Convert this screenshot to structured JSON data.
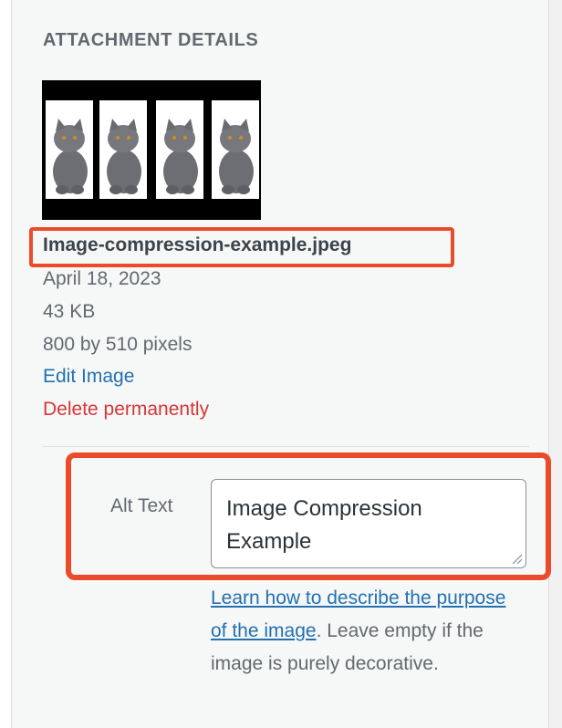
{
  "panel": {
    "heading": "ATTACHMENT DETAILS"
  },
  "file": {
    "name": "Image-compression-example.jpeg",
    "date": "April 18, 2023",
    "size": "43 KB",
    "dimensions": "800 by 510 pixels"
  },
  "actions": {
    "edit_label": "Edit Image",
    "delete_label": "Delete permanently"
  },
  "alt": {
    "label": "Alt Text",
    "value": "Image Compression Example",
    "help_link": "Learn how to describe the purpose of the image",
    "help_text": ". Leave empty if the image is purely decorative."
  },
  "colors": {
    "highlight": "#ea4b2b",
    "link": "#2271b1",
    "danger": "#d63638"
  }
}
